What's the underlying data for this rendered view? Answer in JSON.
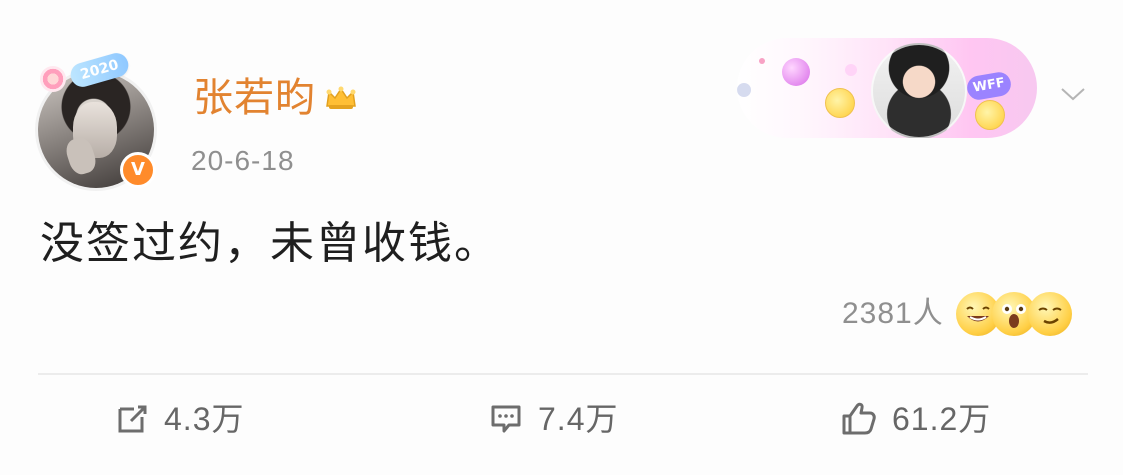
{
  "user": {
    "name": "张若昀",
    "avatar_frame_badge": "2020",
    "verified_badge": "V"
  },
  "post": {
    "date": "20-6-18",
    "text": "没签过约，未曾收钱。"
  },
  "fan_card": {
    "badge": "WFF"
  },
  "reactions": {
    "count": "2381人",
    "icons": [
      "laugh-emoji",
      "surprised-emoji",
      "smirk-emoji"
    ]
  },
  "actions": {
    "share_label": "4.3万",
    "comment_label": "7.4万",
    "like_label": "61.2万"
  },
  "colors": {
    "name": "#e28330",
    "meta": "#8f8f8f",
    "divider": "#ececec"
  }
}
